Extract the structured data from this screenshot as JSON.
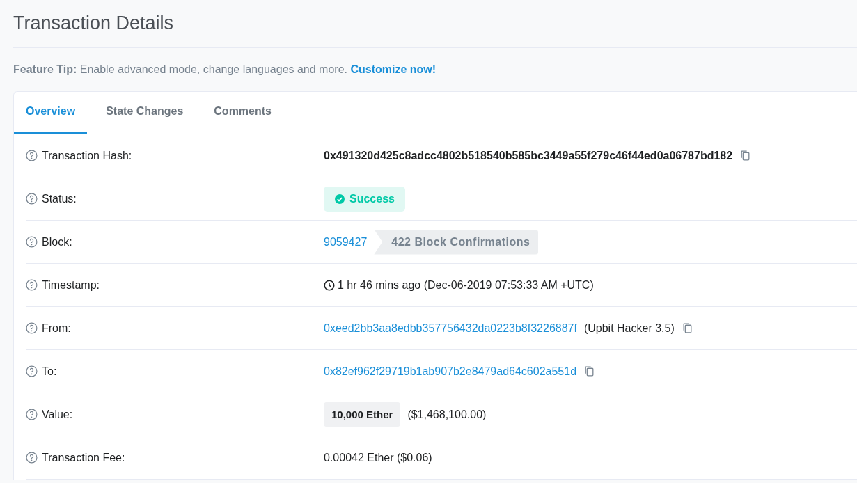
{
  "page_title": "Transaction Details",
  "feature_tip": {
    "label": "Feature Tip:",
    "text": "Enable advanced mode, change languages and more.",
    "link": "Customize now!"
  },
  "tabs": [
    {
      "label": "Overview",
      "selected": true
    },
    {
      "label": "State Changes",
      "selected": false
    },
    {
      "label": "Comments",
      "selected": false
    }
  ],
  "rows": [
    {
      "kind": "hash",
      "label": "Transaction Hash:",
      "value": "0x491320d425c8adcc4802b518540b585bc3449a55f279c46f44ed0a06787bd182"
    },
    {
      "kind": "status",
      "label": "Status:",
      "value": "Success"
    },
    {
      "kind": "block",
      "label": "Block:",
      "value": "9059427",
      "confirmations": "422 Block Confirmations"
    },
    {
      "kind": "timestamp",
      "label": "Timestamp:",
      "value": "1 hr 46 mins ago (Dec-06-2019 07:53:33 AM +UTC)"
    },
    {
      "kind": "address",
      "label": "From:",
      "value": "0xeed2bb3aa8edbb357756432da0223b8f3226887f",
      "tag": "(Upbit Hacker 3.5)"
    },
    {
      "kind": "address",
      "label": "To:",
      "value": "0x82ef962f29719b1ab907b2e8479ad64c602a551d"
    },
    {
      "kind": "value",
      "label": "Value:",
      "value": "10,000 Ether",
      "extra": "($1,468,100.00)"
    },
    {
      "kind": "text",
      "label": "Transaction Fee:",
      "value": "0.00042 Ether ($0.06)"
    }
  ]
}
